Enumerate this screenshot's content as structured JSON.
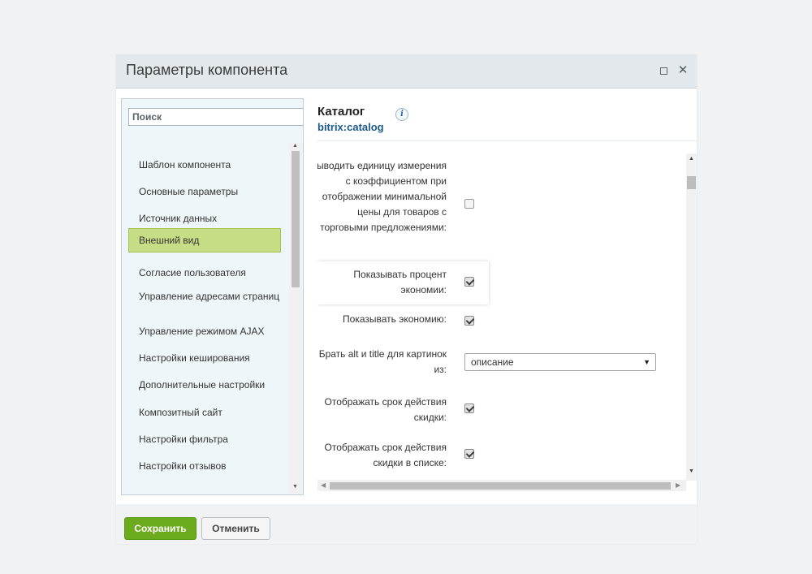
{
  "dialog": {
    "title": "Параметры компонента"
  },
  "sidebar": {
    "search_placeholder": "Поиск",
    "items": [
      {
        "label": "Шаблон компонента"
      },
      {
        "label": "Основные параметры"
      },
      {
        "label": "Источник данных"
      },
      {
        "label": "Внешний вид",
        "active": true
      },
      {
        "label": "Согласие пользователя"
      },
      {
        "label": "Управление адресами страниц"
      },
      {
        "label": "Управление режимом AJAX"
      },
      {
        "label": "Настройки кеширования"
      },
      {
        "label": "Дополнительные настройки"
      },
      {
        "label": "Композитный сайт"
      },
      {
        "label": "Настройки фильтра"
      },
      {
        "label": "Настройки отзывов"
      }
    ]
  },
  "component": {
    "title": "Каталог",
    "code": "bitrix:catalog",
    "info_icon": "i"
  },
  "params": [
    {
      "label": "Выводить единицу измерения с коэффициентом при отображении минимальной цены для товаров с торговыми предложениями:",
      "type": "checkbox",
      "checked": false
    },
    {
      "label": "Показывать процент экономии:",
      "type": "checkbox",
      "checked": true,
      "highlighted": true
    },
    {
      "label": "Показывать экономию:",
      "type": "checkbox",
      "checked": true
    },
    {
      "label": "Брать alt и title для картинок из:",
      "type": "select",
      "value": "описание"
    },
    {
      "label": "Отображать срок действия скидки:",
      "type": "checkbox",
      "checked": true
    },
    {
      "label": "Отображать срок действия скидки в списке:",
      "type": "checkbox",
      "checked": true
    }
  ],
  "footer": {
    "save_label": "Сохранить",
    "cancel_label": "Отменить"
  },
  "colors": {
    "accent_green": "#6cab1d",
    "active_item": "#c7dd85",
    "code_blue": "#1d5a8a"
  }
}
